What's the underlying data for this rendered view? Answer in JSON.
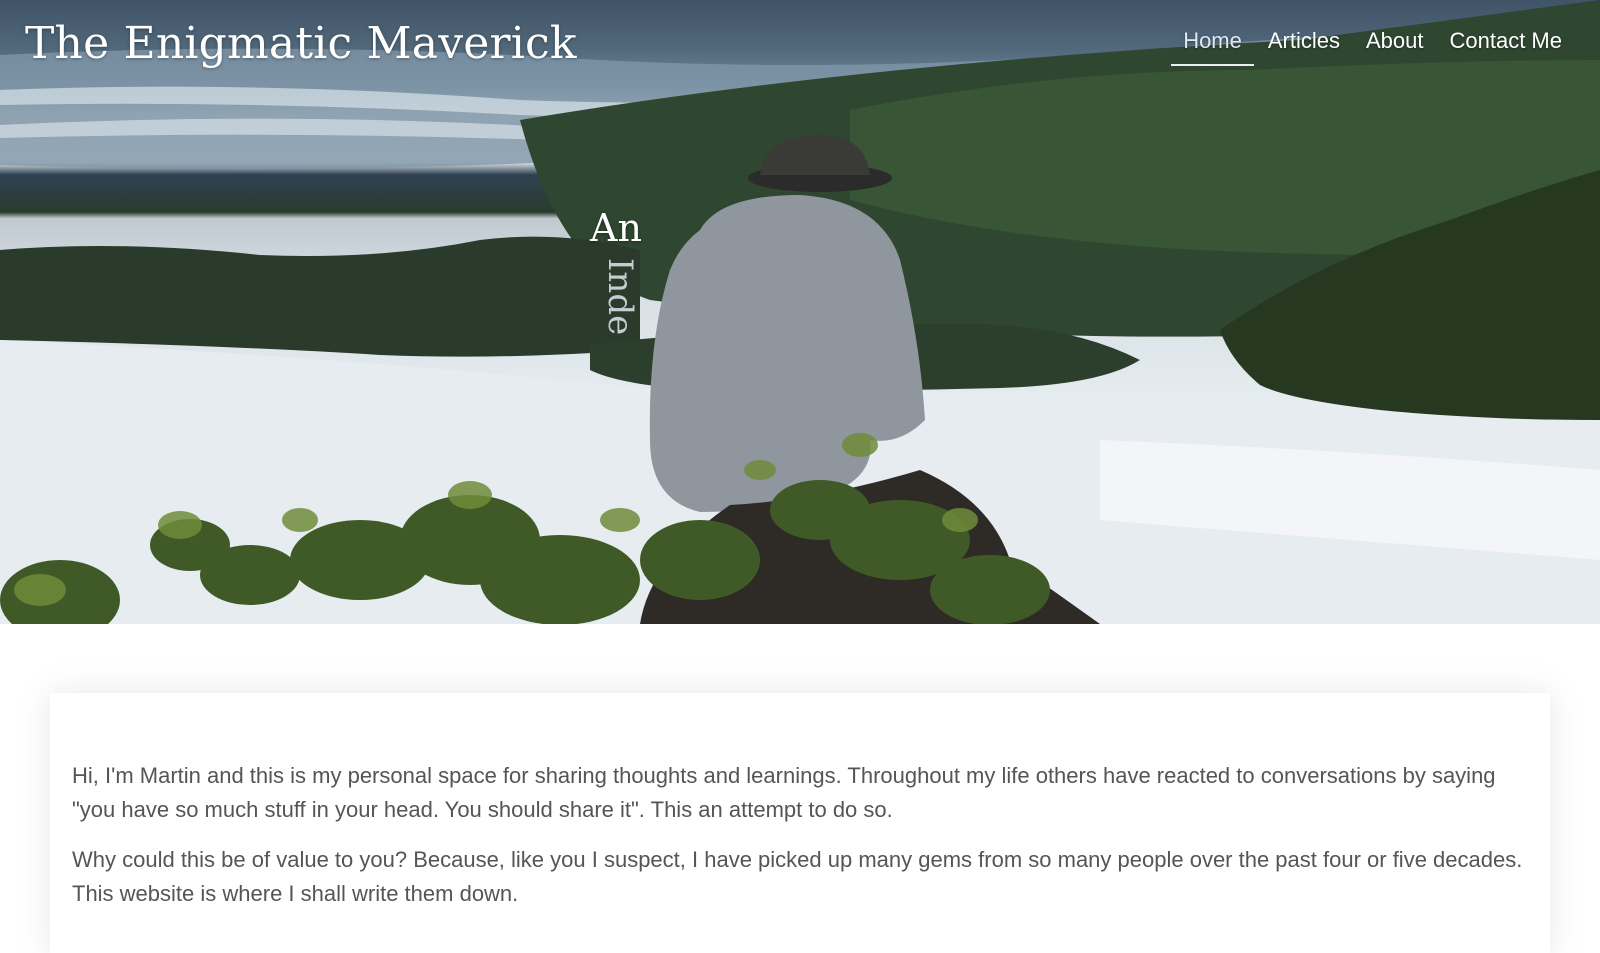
{
  "site": {
    "title": "The Enigmatic Maverick"
  },
  "nav": {
    "items": [
      {
        "label": "Home",
        "active": true
      },
      {
        "label": "Articles",
        "active": false
      },
      {
        "label": "About",
        "active": false
      },
      {
        "label": "Contact Me",
        "active": false
      }
    ]
  },
  "hero": {
    "tagline": "An",
    "tagline_rotated": "Inde"
  },
  "content": {
    "paragraphs": [
      "Hi, I'm Martin and this is my personal space for sharing thoughts and learnings. Throughout my life others have reacted to conversations by saying \"you have so much stuff in your head. You should share it\". This an attempt to do so.",
      "Why could this be of value to you? Because, like you I suspect, I have picked up many gems from so many people over the past four or five decades. This website is where I shall write them down."
    ]
  },
  "colors": {
    "nav_active": "#dfe8f0",
    "text_body": "#555555"
  }
}
